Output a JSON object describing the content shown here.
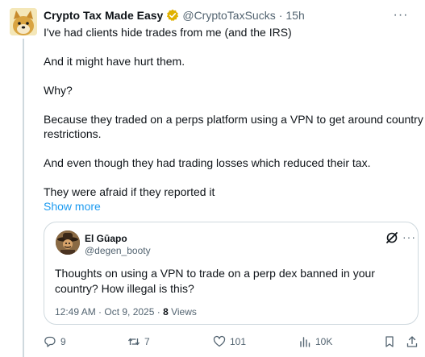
{
  "post": {
    "author_name": "Crypto Tax Made Easy",
    "author_handle": "@CryptoTaxSucks",
    "separator": "·",
    "time": "15h",
    "more_glyph": "···",
    "lines": [
      "I've had clients hide trades from me (and the IRS)",
      "And it might have hurt them.",
      "Why?",
      "Because they traded on a perps platform using a VPN to get around country",
      "restrictions.",
      "And even though they had trading losses which reduced their tax.",
      "They were afraid if they reported it"
    ],
    "show_more": "Show more"
  },
  "quote": {
    "author_name": "El Gūapo",
    "author_handle": "@degen_booty",
    "more_glyph": "···",
    "text": "Thoughts on using a VPN to trade on a perp dex banned in your country? How illegal is this?",
    "timestamp": "12:49 AM · Oct 9, 2025 · ",
    "views_count": "8",
    "views_label": " Views"
  },
  "actions": {
    "replies": "9",
    "reposts": "7",
    "likes": "101",
    "views": "10K"
  },
  "colors": {
    "text": "#0f1419",
    "secondary": "#536471",
    "link": "#1d9bf0",
    "border": "#cfd9de",
    "verified": "#e0b100"
  },
  "icons": {
    "avatar": "doge-avatar",
    "verified": "verified-badge-icon",
    "reply": "reply-icon",
    "repost": "repost-icon",
    "like": "heart-icon",
    "views": "bar-chart-icon",
    "bookmark": "bookmark-icon",
    "share": "share-icon",
    "grok": "grok-icon"
  }
}
